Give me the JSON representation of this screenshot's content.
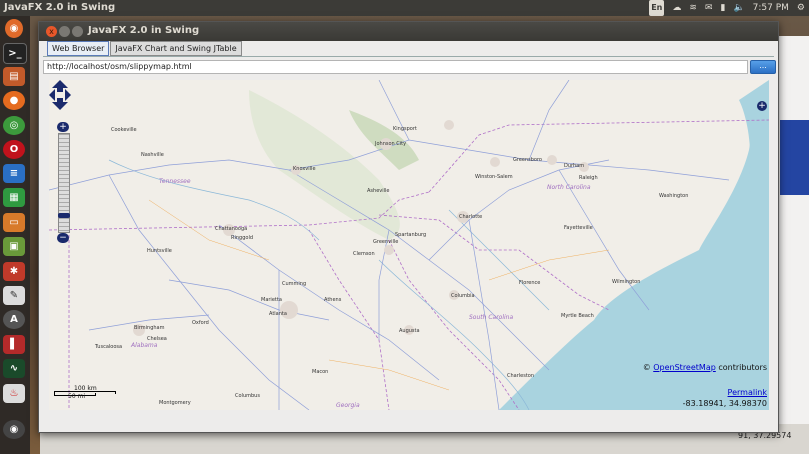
{
  "top_panel": {
    "title": "JavaFX 2.0 in Swing",
    "keyboard": "En",
    "time": "7:57 PM"
  },
  "window": {
    "title": "JavaFX 2.0 in Swing",
    "close_glyph": "x",
    "tabs": [
      {
        "label": "Web Browser",
        "active": true
      },
      {
        "label": "JavaFX Chart and Swing JTable",
        "active": false
      }
    ],
    "url": "http://localhost/osm/slippymap.html",
    "go_label": "..."
  },
  "map": {
    "zoom_in": "+",
    "zoom_out": "−",
    "layer_switcher": "+",
    "attribution_prefix": "©",
    "attribution_link": "OpenStreetMap",
    "attribution_suffix": " contributors",
    "permalink": "Permalink",
    "coordinates": "-83.18941, 34.98370",
    "scale_km": "100 km",
    "scale_mi": "50 mi",
    "states": [
      "Tennessee",
      "North Carolina",
      "South Carolina",
      "Alabama",
      "Georgia"
    ],
    "cities": [
      "Cookeville",
      "Nashville",
      "Kingsport",
      "Johnson City",
      "Knoxville",
      "Greensboro",
      "Durham",
      "Raleigh",
      "Asheville",
      "Winston-Salem",
      "Washington",
      "Chattanooga",
      "Ringgold",
      "Charlotte",
      "Greenville",
      "Spartanburg",
      "Fayetteville",
      "Huntsville",
      "Clemson",
      "Florence",
      "Wilmington",
      "Cumming",
      "Marietta",
      "Athens",
      "Columbia",
      "Birmingham",
      "Oxford",
      "Atlanta",
      "Chelsea",
      "Augusta",
      "Myrtle Beach",
      "Tuscaloosa",
      "Macon",
      "Charleston",
      "Montgomery",
      "Columbus"
    ]
  },
  "background": {
    "status_text": "91, 37.29574"
  },
  "colors": {
    "panel": "#3c3b37",
    "launcher": "#2f2a26",
    "accent_blue": "#1a2a6c",
    "ocean": "#a9d3df",
    "roads": "#8f9fd8"
  }
}
